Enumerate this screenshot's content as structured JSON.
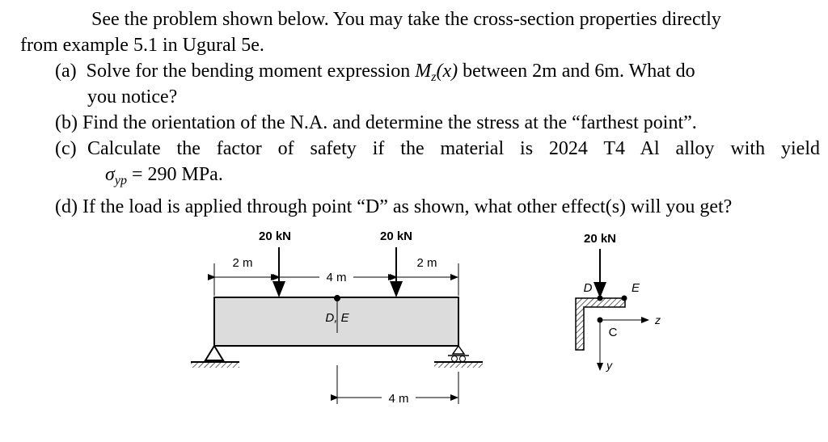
{
  "intro": {
    "line1": "See the problem shown below.  You may take the cross-section properties directly",
    "line2": "from example 5.1 in Ugural 5e."
  },
  "parts": {
    "a": {
      "marker": "(a)",
      "text_before": "Solve for the bending moment expression ",
      "symbol": "M",
      "subscript": "z",
      "arg": "(x)",
      "text_after": " between 2m and 6m.  What do",
      "continuation": "you notice?"
    },
    "b": {
      "marker": "(b)",
      "text": "Find the orientation of the N.A. and determine the stress at the “farthest point”."
    },
    "c": {
      "marker": "(c)",
      "text": "Calculate the factor of safety if the material is 2024 T4 Al alloy with yield",
      "symbol": "σ",
      "subscript": "yp",
      "value": " = 290 MPa."
    },
    "d": {
      "marker": "(d)",
      "text": "If the load is applied through point “D” as shown, what other effect(s) will you get?"
    }
  },
  "figure": {
    "beam": {
      "load_left": "20 kN",
      "load_right": "20 kN",
      "dim_left": "2 m",
      "dim_middle": "4 m",
      "dim_right": "2 m",
      "dim_bottom": "4 m",
      "point_label": "D, E"
    },
    "section": {
      "load": "20 kN",
      "point_d": "D",
      "point_e": "E",
      "centroid": "C",
      "axis_z": "z",
      "axis_y": "y"
    },
    "colors": {
      "beam_fill": "#dcdcdc",
      "line": "#000000"
    }
  }
}
